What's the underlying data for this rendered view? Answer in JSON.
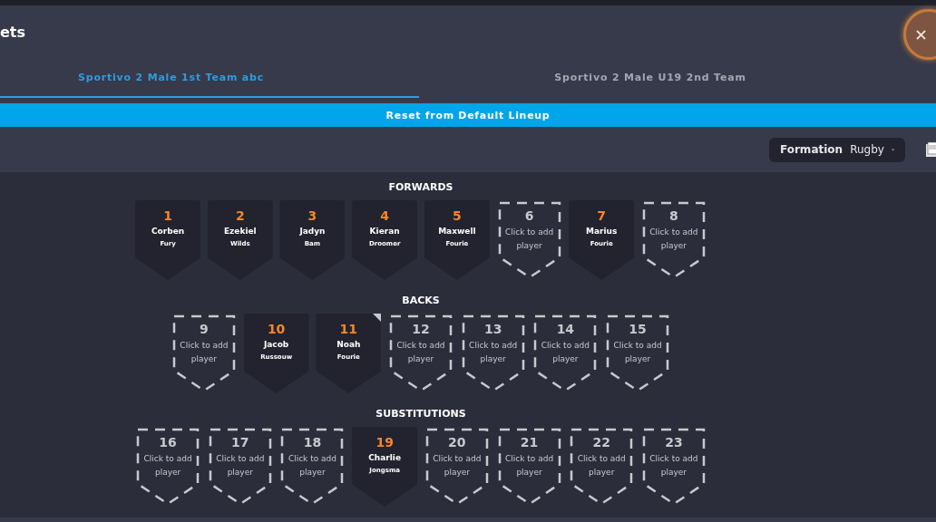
{
  "modal": {
    "title": "ets"
  },
  "tabs": [
    {
      "label": "Sportivo 2 Male 1st Team abc",
      "selected": true
    },
    {
      "label": "Sportivo 2 Male U19 2nd Team",
      "selected": false
    }
  ],
  "reset_button": "Reset from Default Lineup",
  "formation": {
    "label": "Formation",
    "value": "Rugby"
  },
  "sections": [
    {
      "title": "FORWARDS",
      "slots": [
        {
          "number": "1",
          "first": "Corben",
          "last": "Fury"
        },
        {
          "number": "2",
          "first": "Ezekiel",
          "last": "Wilds"
        },
        {
          "number": "3",
          "first": "Jadyn",
          "last": "Bam"
        },
        {
          "number": "4",
          "first": "Kieran",
          "last": "Droomer"
        },
        {
          "number": "5",
          "first": "Maxwell",
          "last": "Fourie"
        },
        {
          "number": "6",
          "empty_text": "Click to add player"
        },
        {
          "number": "7",
          "first": "Marius",
          "last": "Fourie"
        },
        {
          "number": "8",
          "empty_text": "Click to add player"
        }
      ]
    },
    {
      "title": "BACKS",
      "slots": [
        {
          "number": "9",
          "empty_text": "Click to add player"
        },
        {
          "number": "10",
          "first": "Jacob",
          "last": "Russouw"
        },
        {
          "number": "11",
          "first": "Noah",
          "last": "Fourie",
          "flagged": true
        },
        {
          "number": "12",
          "empty_text": "Click to add player"
        },
        {
          "number": "13",
          "empty_text": "Click to add player"
        },
        {
          "number": "14",
          "empty_text": "Click to add player"
        },
        {
          "number": "15",
          "empty_text": "Click to add player"
        }
      ]
    },
    {
      "title": "SUBSTITUTIONS",
      "slots": [
        {
          "number": "16",
          "empty_text": "Click to add player"
        },
        {
          "number": "17",
          "empty_text": "Click to add player"
        },
        {
          "number": "18",
          "empty_text": "Click to add player"
        },
        {
          "number": "19",
          "first": "Charlie",
          "last": "Jongsma"
        },
        {
          "number": "20",
          "empty_text": "Click to add player"
        },
        {
          "number": "21",
          "empty_text": "Click to add player"
        },
        {
          "number": "22",
          "empty_text": "Click to add player"
        },
        {
          "number": "23",
          "empty_text": "Click to add player"
        }
      ]
    }
  ]
}
